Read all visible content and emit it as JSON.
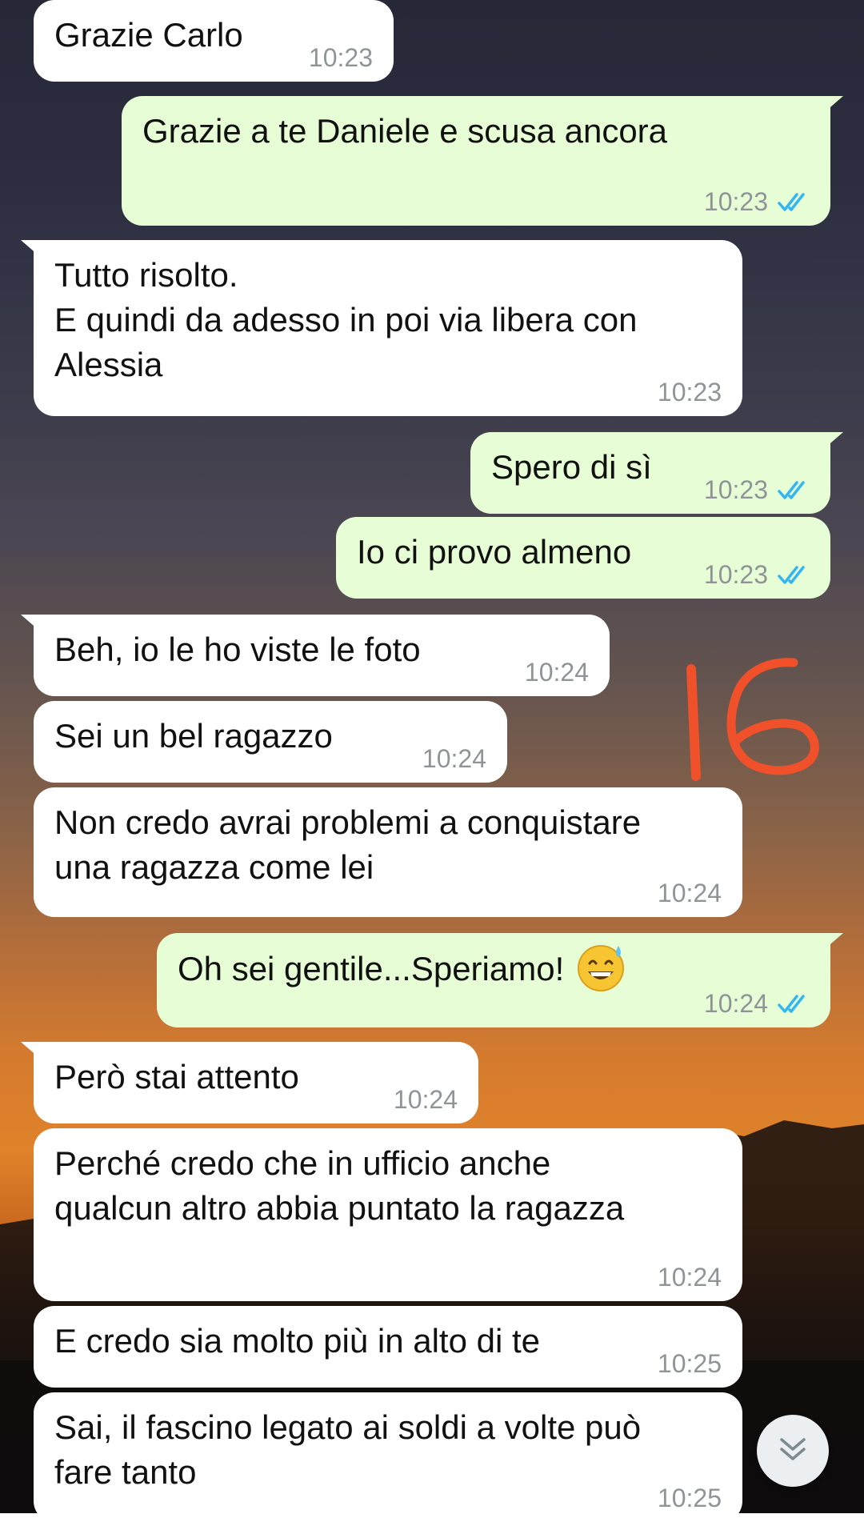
{
  "messages": [
    {
      "direction": "in",
      "text": "Grazie Carlo",
      "time": "10:23"
    },
    {
      "direction": "out",
      "text": "Grazie a te Daniele e scusa ancora",
      "time": "10:23",
      "status": "read"
    },
    {
      "direction": "in",
      "text": "Tutto risolto.\nE quindi da adesso in poi via libera con\nAlessia",
      "time": "10:23"
    },
    {
      "direction": "out",
      "text": "Spero di sì",
      "time": "10:23",
      "status": "read"
    },
    {
      "direction": "out",
      "text": "Io ci provo almeno",
      "time": "10:23",
      "status": "read"
    },
    {
      "direction": "in",
      "text": "Beh, io le ho viste le foto",
      "time": "10:24"
    },
    {
      "direction": "in",
      "text": "Sei un bel ragazzo",
      "time": "10:24"
    },
    {
      "direction": "in",
      "text": "Non credo avrai problemi a conquistare\nuna ragazza come lei",
      "time": "10:24"
    },
    {
      "direction": "out",
      "text": "Oh sei gentile...Speriamo!",
      "emoji": "grinning-face-with-sweat",
      "time": "10:24",
      "status": "read"
    },
    {
      "direction": "in",
      "text": "Però stai attento",
      "time": "10:24"
    },
    {
      "direction": "in",
      "text": "Perché credo che in ufficio anche\nqualcun altro abbia puntato la ragazza",
      "time": "10:24"
    },
    {
      "direction": "in",
      "text": "E credo sia molto più in alto di te",
      "time": "10:25"
    },
    {
      "direction": "in",
      "text": "Sai, il fascino legato ai soldi a volte può\nfare tanto",
      "time": "10:25"
    }
  ],
  "annotation": {
    "text": "16",
    "color": "#f0502a"
  },
  "colors": {
    "incoming_bubble": "#ffffff",
    "outgoing_bubble": "#e7fdd6",
    "read_ticks": "#34b7f1",
    "timestamp": "#8f9597"
  },
  "icons": {
    "scroll_down": "double-chevron-down-icon",
    "read_receipt": "double-check-icon"
  }
}
